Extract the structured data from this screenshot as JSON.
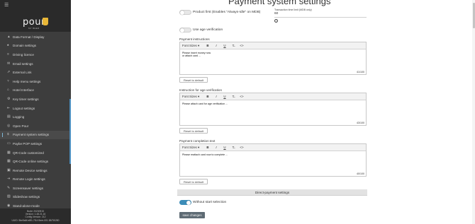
{
  "page": {
    "title": "Payment system settings"
  },
  "sidebar": {
    "brand": "pour",
    "brand_sub": "MY BEER",
    "items": [
      {
        "icon": "▲",
        "label": "Data Format / Display"
      },
      {
        "icon": "♠",
        "label": "Domain settings"
      },
      {
        "icon": "≡",
        "label": "Driving licence"
      },
      {
        "icon": "✉",
        "label": "Email settings"
      },
      {
        "icon": "⇗",
        "label": "External Link"
      },
      {
        "icon": "?",
        "label": "Help menu settings"
      },
      {
        "icon": "⌂",
        "label": "Hotel Interface"
      },
      {
        "icon": "⚙",
        "label": "Key timer settings"
      },
      {
        "icon": "⇤",
        "label": "Logout settings"
      },
      {
        "icon": "▤",
        "label": "Logging"
      },
      {
        "icon": "◎",
        "label": "Open Pour"
      },
      {
        "icon": "$",
        "label": "Payment system settings"
      },
      {
        "icon": "▭",
        "label": "Paybe POP settings"
      },
      {
        "icon": "▦",
        "label": "QR-Code customized"
      },
      {
        "icon": "▦",
        "label": "QR-Code online settings"
      },
      {
        "icon": "▣",
        "label": "Remote Device settings"
      },
      {
        "icon": "⇥",
        "label": "Remote Login settings"
      },
      {
        "icon": "✎",
        "label": "Screensaver settings"
      },
      {
        "icon": "▧",
        "label": "Slideshow settings"
      },
      {
        "icon": "◉",
        "label": "Stand-alone-mode"
      }
    ],
    "active_index": 11,
    "footer": {
      "line1": "Build: 20230915",
      "line2": "Version: 1.48.21.16",
      "line3": "Config-Version: 212",
      "line4": "UUID: 5be5a6f-e8f1-7f14 Beer-001 88/78/280"
    }
  },
  "settings": {
    "product_first_label": "Product first (Enables \"Always-Idle\" on MDB)",
    "age_verification_label": "Use age verification",
    "transaction_label": "Transaction time limit (MDB only)",
    "transaction_value": "60",
    "info_glyph": "i"
  },
  "toolbar": {
    "font_sizes": "Font Sizes ▾",
    "bold": "B",
    "italic": "I",
    "underline": "U",
    "clear": "T̶",
    "code": "<>"
  },
  "editors": [
    {
      "label": "Payment instructions",
      "text": "Please insert money now\nor attach card ...",
      "counter": "41/100",
      "reset": "Reset to default"
    },
    {
      "label": "Instruction for age verification",
      "text": "Please attach card for age verification ...",
      "counter": "43/100",
      "reset": "Reset to default"
    },
    {
      "label": "Payment completion text",
      "text": "Please reattach card now to complete ...",
      "counter": "40/100",
      "reset": "Reset to default"
    }
  ],
  "direct_payment": {
    "header": "Direct-payment settings",
    "without_start_label": "Without start selection"
  },
  "save_label": "save changes",
  "colors": {
    "sidebar": "#3d3d3d",
    "accent": "#3c8db8",
    "save": "#5e6b74"
  }
}
